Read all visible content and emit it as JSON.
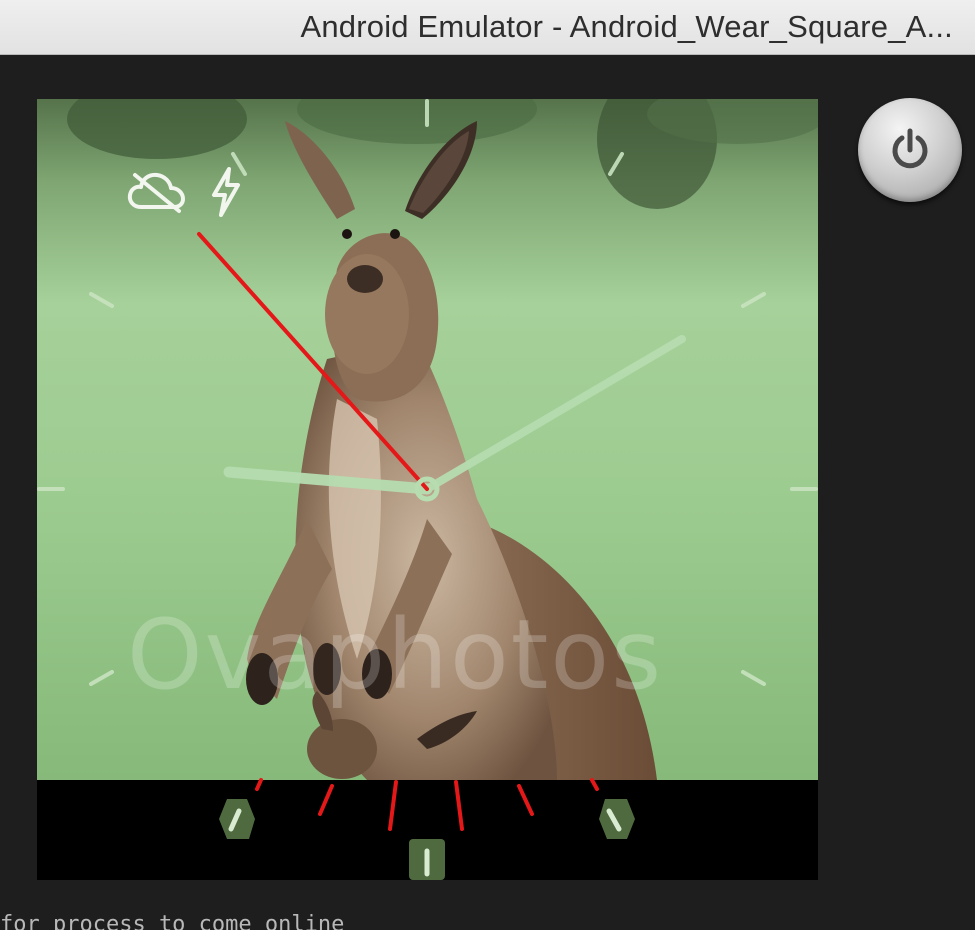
{
  "window": {
    "title": "Android Emulator - Android_Wear_Square_A..."
  },
  "watch_face": {
    "watermark_text": "Ovaphotos",
    "hand_color": "#b6dcb0",
    "second_hand_color": "#e41818",
    "status_icons": [
      "cloud-off-icon",
      "flash-icon"
    ]
  },
  "controls": {
    "power_icon": "power-icon"
  },
  "console": {
    "text": "for process to come online"
  }
}
